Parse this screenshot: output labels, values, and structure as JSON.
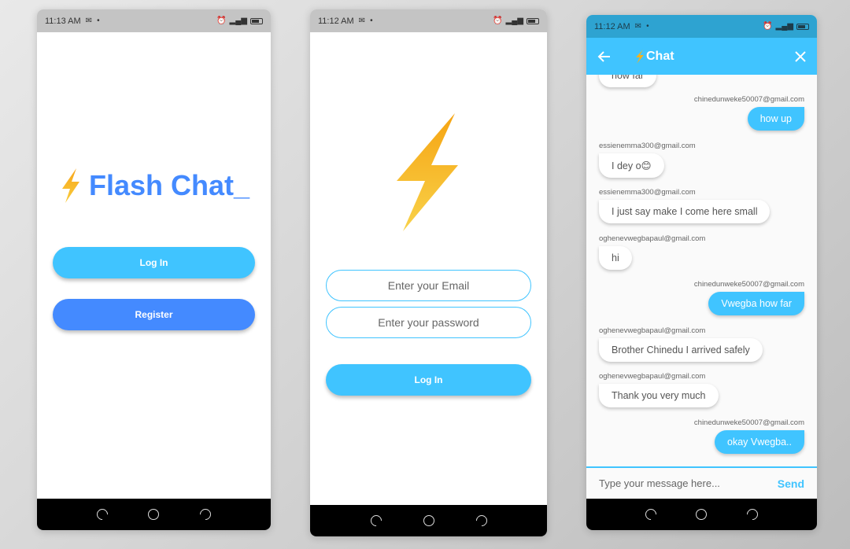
{
  "colors": {
    "accent": "#40c4ff",
    "brand_blue": "#448aff",
    "bolt": "#f5b21b"
  },
  "phone1": {
    "status": {
      "time": "11:13 AM"
    },
    "title": "Flash Chat_",
    "login_label": "Log In",
    "register_label": "Register"
  },
  "phone2": {
    "status": {
      "time": "11:12 AM"
    },
    "email_placeholder": "Enter your Email",
    "password_placeholder": "Enter your password",
    "login_label": "Log In"
  },
  "phone3": {
    "status": {
      "time": "11:12 AM"
    },
    "appbar_title": "Chat",
    "messages": [
      {
        "sender": "",
        "text": "how far",
        "side": "left"
      },
      {
        "sender": "chinedunweke50007@gmail.com",
        "text": "how up",
        "side": "right"
      },
      {
        "sender": "essienemma300@gmail.com",
        "text": "I dey o😊",
        "side": "left"
      },
      {
        "sender": "essienemma300@gmail.com",
        "text": "I just say make I come here small",
        "side": "left"
      },
      {
        "sender": "oghenevwegbapaul@gmail.com",
        "text": "hi",
        "side": "left"
      },
      {
        "sender": "chinedunweke50007@gmail.com",
        "text": "Vwegba how far",
        "side": "right"
      },
      {
        "sender": "oghenevwegbapaul@gmail.com",
        "text": "Brother Chinedu I arrived safely",
        "side": "left"
      },
      {
        "sender": "oghenevwegbapaul@gmail.com",
        "text": "Thank you very much",
        "side": "left"
      },
      {
        "sender": "chinedunweke50007@gmail.com",
        "text": "okay Vwegba..",
        "side": "right"
      }
    ],
    "message_placeholder": "Type your message here...",
    "send_label": "Send"
  }
}
